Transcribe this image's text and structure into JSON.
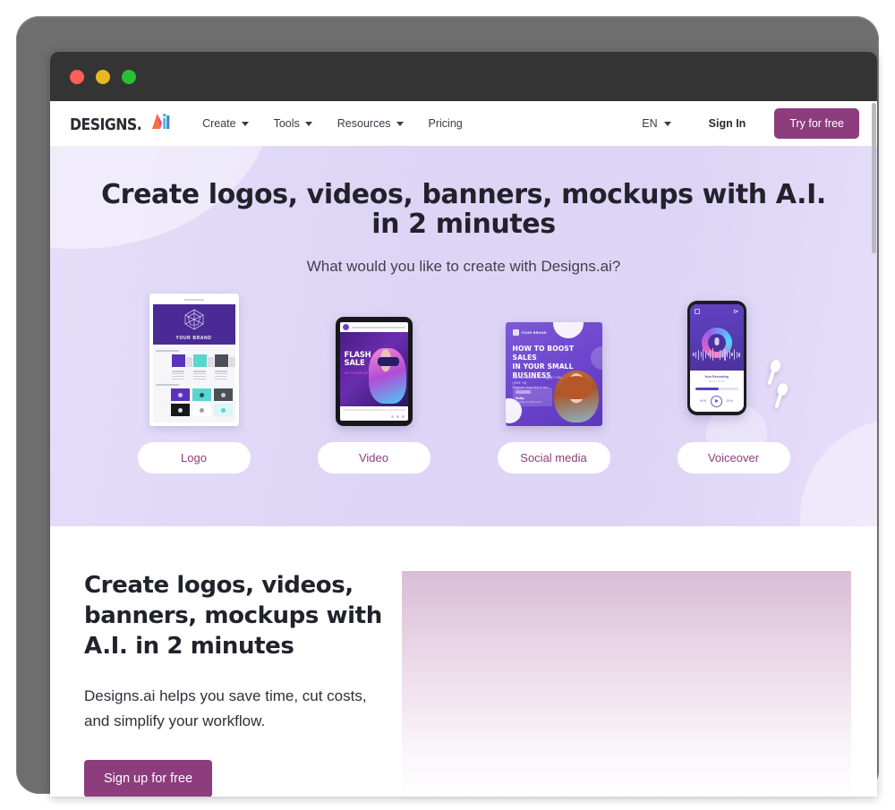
{
  "window": {
    "traffic_lights": [
      "close",
      "minimize",
      "maximize"
    ]
  },
  "navbar": {
    "logo_word": "DESIGNS.",
    "logo_mark": "ai-logo-icon",
    "links": [
      {
        "label": "Create",
        "has_dropdown": true
      },
      {
        "label": "Tools",
        "has_dropdown": true
      },
      {
        "label": "Resources",
        "has_dropdown": true
      },
      {
        "label": "Pricing",
        "has_dropdown": false
      }
    ],
    "language": "EN",
    "sign_in": "Sign In",
    "cta": "Try for free"
  },
  "hero": {
    "title_line1": "Create logos, videos, banners, mockups with A.I.",
    "title_line2": "in 2 minutes",
    "subtitle": "What would you like to create with Designs.ai?",
    "cards": [
      {
        "label": "Logo",
        "art": "brand-style-guide-mockup",
        "brand_text": "YOUR BRAND"
      },
      {
        "label": "Video",
        "art": "tablet-video-mockup",
        "headline_line1": "FLASH",
        "headline_line2": "SALE",
        "subline": "UP TO 50% OFF"
      },
      {
        "label": "Social media",
        "art": "social-post-mockup",
        "brand_text": "YOUR BRAND",
        "headline_line1": "HOW TO BOOST SALES",
        "headline_line2": "IN YOUR SMALL BUSINESS",
        "meta_line1": "Join our webinar, 29 Aug @ 7:30pm (GMT +8)",
        "meta_line2": "Register Now! link in bio.",
        "speaker_tag": "Speaker",
        "speaker_name": "Abby",
        "speaker_role": "Founder of boss focus"
      },
      {
        "label": "Voiceover",
        "art": "phone-voice-recorder-mockup",
        "recording_title": "Your Recording",
        "recording_time": "00:45 / 01:20"
      }
    ]
  },
  "feature": {
    "title": "Create logos, videos, banners, mockups with A.I. in 2 minutes",
    "body": "Designs.ai helps you save time, cut costs, and simplify your workflow.",
    "cta": "Sign up for free",
    "media": "hero-product-image-placeholder"
  },
  "colors": {
    "brand_purple": "#8d3c7d",
    "hero_lavender": "#ded5f6",
    "heading_dark": "#22222c",
    "titlebar": "#343434",
    "bezel": "#6e6e6e"
  }
}
